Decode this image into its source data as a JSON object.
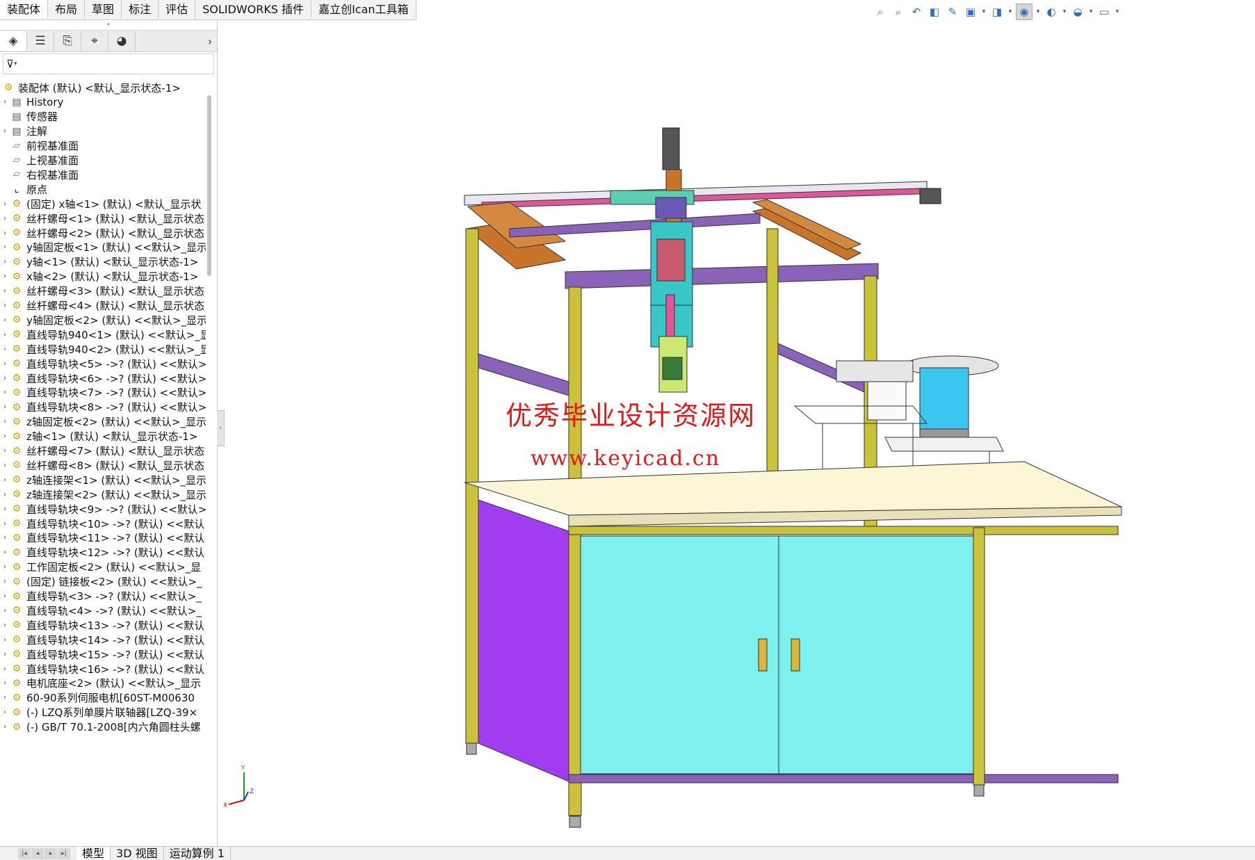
{
  "tabs": [
    "装配体",
    "布局",
    "草图",
    "标注",
    "评估",
    "SOLIDWORKS 插件",
    "嘉立创Ican工具箱"
  ],
  "hud_icons": [
    "zoom-to-fit-icon",
    "zoom-to-area-icon",
    "previous-view-icon",
    "section-view-icon",
    "dynamic-annotation-icon",
    "view-orientation-icon",
    "display-style-icon",
    "hide-show-items-icon",
    "edit-appearance-icon",
    "apply-scene-icon",
    "view-settings-icon"
  ],
  "panel": {
    "tab_icons": [
      "feature-manager-icon",
      "property-manager-icon",
      "configuration-manager-icon",
      "dimxpert-icon",
      "display-manager-icon"
    ],
    "filter_icon": "filter-icon",
    "tree": [
      {
        "label": "装配体 (默认) <默认_显示状态-1>",
        "icon": "asm",
        "exp": "",
        "root": true
      },
      {
        "label": "History",
        "icon": "folder",
        "exp": "›"
      },
      {
        "label": "传感器",
        "icon": "folder",
        "exp": ""
      },
      {
        "label": "注解",
        "icon": "folder",
        "exp": "›"
      },
      {
        "label": "前视基准面",
        "icon": "plane",
        "exp": ""
      },
      {
        "label": "上视基准面",
        "icon": "plane",
        "exp": ""
      },
      {
        "label": "右视基准面",
        "icon": "plane",
        "exp": ""
      },
      {
        "label": "原点",
        "icon": "origin",
        "exp": ""
      },
      {
        "label": "(固定) x轴<1> (默认) <默认_显示状",
        "icon": "asm",
        "exp": "›"
      },
      {
        "label": "丝杆螺母<1> (默认) <默认_显示状态",
        "icon": "asm",
        "exp": "›"
      },
      {
        "label": "丝杆螺母<2> (默认) <默认_显示状态",
        "icon": "asm",
        "exp": "›"
      },
      {
        "label": "y轴固定板<1> (默认) <<默认>_显示",
        "icon": "asm",
        "exp": "›"
      },
      {
        "label": "y轴<1> (默认) <默认_显示状态-1>",
        "icon": "asm",
        "exp": "›"
      },
      {
        "label": "x轴<2> (默认) <默认_显示状态-1>",
        "icon": "asm",
        "exp": "›"
      },
      {
        "label": "丝杆螺母<3> (默认) <默认_显示状态",
        "icon": "asm",
        "exp": "›"
      },
      {
        "label": "丝杆螺母<4> (默认) <默认_显示状态",
        "icon": "asm",
        "exp": "›"
      },
      {
        "label": "y轴固定板<2> (默认) <<默认>_显示",
        "icon": "asm",
        "exp": "›"
      },
      {
        "label": "直线导轨940<1> (默认) <<默认>_显",
        "icon": "asm",
        "exp": "›"
      },
      {
        "label": "直线导轨940<2> (默认) <<默认>_显",
        "icon": "asm",
        "exp": "›"
      },
      {
        "label": "直线导轨块<5> ->? (默认) <<默认>",
        "icon": "asm",
        "exp": "›"
      },
      {
        "label": "直线导轨块<6> ->? (默认) <<默认>",
        "icon": "asm",
        "exp": "›"
      },
      {
        "label": "直线导轨块<7> ->? (默认) <<默认>",
        "icon": "asm",
        "exp": "›"
      },
      {
        "label": "直线导轨块<8> ->? (默认) <<默认>",
        "icon": "asm",
        "exp": "›"
      },
      {
        "label": "z轴固定板<2> (默认) <<默认>_显示",
        "icon": "asm",
        "exp": "›"
      },
      {
        "label": "z轴<1> (默认) <默认_显示状态-1>",
        "icon": "asm",
        "exp": "›"
      },
      {
        "label": "丝杆螺母<7> (默认) <默认_显示状态",
        "icon": "asm",
        "exp": "›"
      },
      {
        "label": "丝杆螺母<8> (默认) <默认_显示状态",
        "icon": "asm",
        "exp": "›"
      },
      {
        "label": "z轴连接架<1> (默认) <<默认>_显示",
        "icon": "asm",
        "exp": "›"
      },
      {
        "label": "z轴连接架<2> (默认) <<默认>_显示",
        "icon": "asm",
        "exp": "›"
      },
      {
        "label": "直线导轨块<9> ->? (默认) <<默认>",
        "icon": "asm",
        "exp": "›"
      },
      {
        "label": "直线导轨块<10> ->? (默认) <<默认",
        "icon": "asm",
        "exp": "›"
      },
      {
        "label": "直线导轨块<11> ->? (默认) <<默认",
        "icon": "asm",
        "exp": "›"
      },
      {
        "label": "直线导轨块<12> ->? (默认) <<默认",
        "icon": "asm",
        "exp": "›"
      },
      {
        "label": "工作固定板<2> (默认) <<默认>_显",
        "icon": "asm",
        "exp": "›"
      },
      {
        "label": "(固定) 链接板<2> (默认) <<默认>_",
        "icon": "asm",
        "exp": "›"
      },
      {
        "label": "直线导轨<3> ->? (默认) <<默认>_",
        "icon": "asm",
        "exp": "›"
      },
      {
        "label": "直线导轨<4> ->? (默认) <<默认>_",
        "icon": "asm",
        "exp": "›"
      },
      {
        "label": "直线导轨块<13> ->? (默认) <<默认",
        "icon": "asm",
        "exp": "›"
      },
      {
        "label": "直线导轨块<14> ->? (默认) <<默认",
        "icon": "asm",
        "exp": "›"
      },
      {
        "label": "直线导轨块<15> ->? (默认) <<默认",
        "icon": "asm",
        "exp": "›"
      },
      {
        "label": "直线导轨块<16> ->? (默认) <<默认",
        "icon": "asm",
        "exp": "›"
      },
      {
        "label": "电机底座<2> (默认) <<默认>_显示",
        "icon": "asm",
        "exp": "›"
      },
      {
        "label": "60-90系列伺服电机[60ST-M00630",
        "icon": "asm",
        "exp": "›"
      },
      {
        "label": "(-) LZQ系列单膜片联轴器[LZQ-39×",
        "icon": "asm",
        "exp": "›"
      },
      {
        "label": "(-) GB/T 70.1-2008[内六角圆柱头螺",
        "icon": "asm",
        "exp": "›"
      }
    ]
  },
  "bottom_tabs": [
    "模型",
    "3D 视图",
    "运动算例 1"
  ],
  "watermark": {
    "line1": "优秀毕业设计资源网",
    "line2": "www.keyicad.cn"
  },
  "triad": {
    "x": "X",
    "y": "Y",
    "z": "Z"
  },
  "colors": {
    "frame": "#c9c23a",
    "beam": "#8a62b8",
    "rail_orange": "#c8742a",
    "cabinet_door": "#7ef0ee",
    "side_panel": "#a23cf0",
    "tabletop": "#fcf6d6",
    "watermark": "#e01818"
  }
}
